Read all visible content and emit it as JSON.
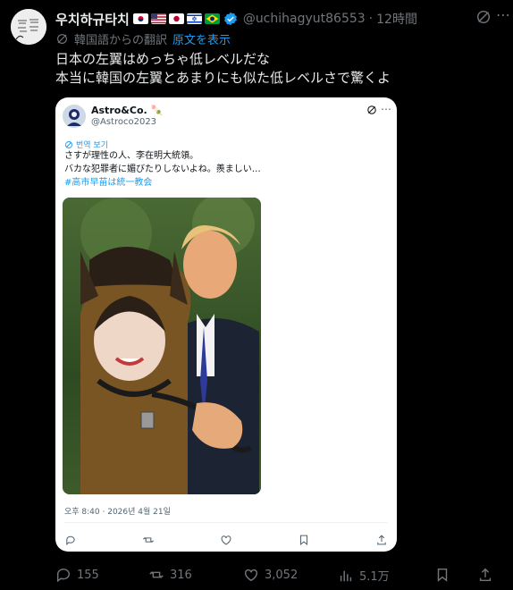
{
  "post": {
    "display_name": "우치하규타치",
    "flags": [
      {
        "name": "south-korea-flag",
        "bg": "#ffffff",
        "fg": "#c60c30"
      },
      {
        "name": "usa-flag",
        "bg": "#b22234",
        "fg": "#ffffff"
      },
      {
        "name": "japan-flag",
        "bg": "#ffffff",
        "fg": "#bc002d"
      },
      {
        "name": "israel-flag",
        "bg": "#ffffff",
        "fg": "#0038b8"
      },
      {
        "name": "brazil-flag",
        "bg": "#009c3b",
        "fg": "#ffdf00"
      }
    ],
    "handle": "@uchihagyut86553",
    "separator": "·",
    "time": "12時間",
    "translate_label": "韓国語からの翻訳",
    "show_original": "原文を表示",
    "body_lines": [
      "日本の左翼はめっちゃ低レベルだな",
      "本当に韓国の左翼とあまりにも似た低レベルさで驚くよ"
    ]
  },
  "quote": {
    "display_name": "Astro&Co. 🍡",
    "handle": "@Astroco2023",
    "translate_label": "번역 보기",
    "lines": [
      "さすが理性の人、李在明大統領。",
      "バカな犯罪者に媚びたりしないよね。羨ましい…"
    ],
    "hashtag": "#高市早苗は統一教会",
    "meta": "오후 8:40 · 2026년 4월 21일"
  },
  "actions": {
    "replies": "155",
    "reposts": "316",
    "likes": "3,052",
    "views": "5.1万"
  },
  "colors": {
    "background": "#000000",
    "text": "#e7e9ea",
    "muted": "#71767b",
    "accent": "#1d9bf0",
    "verified": "#1d9bf0"
  }
}
